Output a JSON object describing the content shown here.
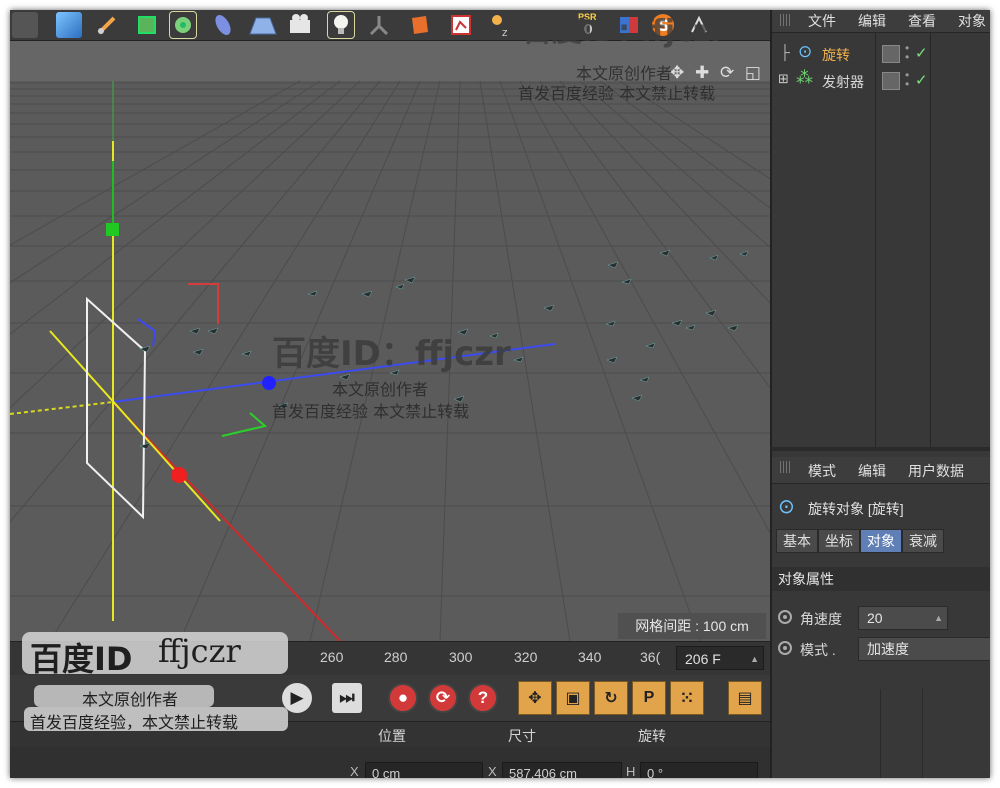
{
  "toolbar": {
    "icons": [
      "cube-icon",
      "pen-icon",
      "subdivision-icon",
      "array-icon",
      "deformer-icon",
      "floor-icon",
      "camera-icon",
      "light-icon",
      "character-icon",
      "tag-icon",
      "render-icon",
      "xyz-icon",
      "psr-icon",
      "material-icon",
      "snap-icon"
    ],
    "psr_label": "PSR",
    "psr_value": "0"
  },
  "viewport": {
    "nav_icons": "✥ ✚ ⟳ ◱",
    "grid_readout": "网格间距 : 100 cm"
  },
  "timeline": {
    "ticks": [
      "260",
      "280",
      "300",
      "320",
      "340",
      "36("
    ],
    "frame_value": "206 F"
  },
  "transport": {
    "goto_end": "⏭",
    "record": "●",
    "auto_key": "⟳",
    "help": "?",
    "move_icon": "✥",
    "scale_icon": "▣",
    "rotate_icon": "↻",
    "p_icon": "P",
    "dots_icon": "⁙",
    "film_icon": "▤"
  },
  "coords": {
    "headers": {
      "position": "位置",
      "size": "尺寸",
      "rotation": "旋转"
    },
    "x_label": "X",
    "x_value": "0 cm",
    "sx_label": "X",
    "sx_value": "587.406 cm",
    "h_label": "H",
    "h_value": "0 °"
  },
  "object_manager": {
    "menu": [
      "文件",
      "编辑",
      "查看",
      "对象"
    ],
    "objects": [
      {
        "name": "旋转",
        "color": "#f3b14c"
      },
      {
        "name": "发射器",
        "color": "#d8d8d8"
      }
    ]
  },
  "attribute_manager": {
    "menu": [
      "模式",
      "编辑",
      "用户数据"
    ],
    "title": "旋转对象 [旋转]",
    "tabs": [
      "基本",
      "坐标",
      "对象",
      "衰减"
    ],
    "active_tab": "对象",
    "section": "对象属性",
    "angular_speed_label": "角速度",
    "angular_speed_value": "20",
    "mode_label": "模式 .",
    "mode_value": "加速度"
  },
  "watermarks": {
    "id_text": "百度ID：ffjczr",
    "author": "本文原创作者",
    "notice": "首发百度经验  本文禁止转载",
    "corner_id": "百度ID",
    "corner_name": "ffjczr",
    "corner_author": "本文原创作者",
    "corner_notice": "首发百度经验，本文禁止转载",
    "top_id": "百度ID: ffjczr",
    "top_author": "本文原创作者",
    "top_notice": "首发百度经验  本文禁止转载"
  }
}
